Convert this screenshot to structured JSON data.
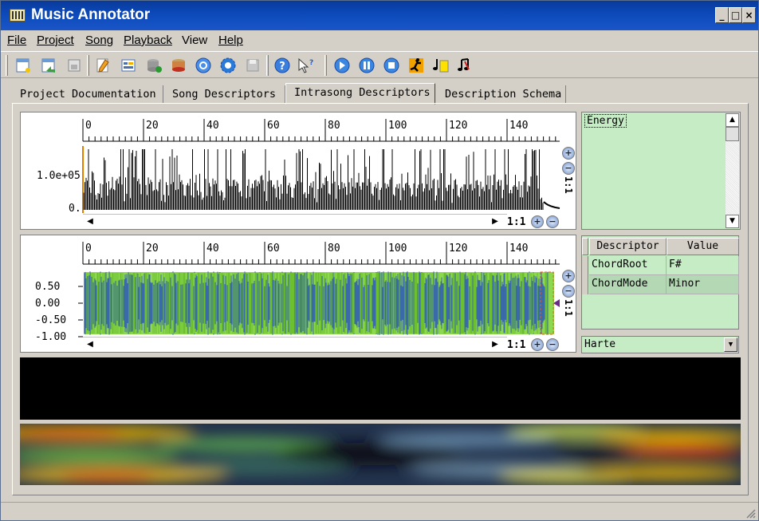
{
  "window": {
    "title": "Music Annotator",
    "min_label": "_",
    "max_label": "□",
    "close_label": "×"
  },
  "menu": [
    "File",
    "Project",
    "Song",
    "Playback",
    "View",
    "Help"
  ],
  "tabs": [
    {
      "label": "Project Documentation",
      "active": false
    },
    {
      "label": "Song Descriptors",
      "active": false
    },
    {
      "label": "Intrasong Descriptors",
      "active": true
    },
    {
      "label": "Description Schema",
      "active": false
    }
  ],
  "energy_plot": {
    "x_ticks": [
      "0",
      "20",
      "40",
      "60",
      "80",
      "100",
      "120",
      "140"
    ],
    "y_ticks": [
      "1.0e+05",
      "0."
    ],
    "zoom_ratio": "1:1",
    "v_ratio": "1:1"
  },
  "wave_plot": {
    "x_ticks": [
      "0",
      "20",
      "40",
      "60",
      "80",
      "100",
      "120",
      "140"
    ],
    "y_ticks": [
      "0.50",
      "0.00",
      "-0.50",
      "-1.00"
    ],
    "zoom_ratio": "1:1",
    "v_ratio": "1:1"
  },
  "descriptor_list": {
    "selected": "Energy"
  },
  "descriptor_table": {
    "headers": [
      "Descriptor",
      "Value"
    ],
    "rows": [
      {
        "descriptor": "ChordRoot",
        "value": "F#"
      },
      {
        "descriptor": "ChordMode",
        "value": "Minor"
      }
    ]
  },
  "schema_select": {
    "value": "Harte"
  },
  "icons": [
    "new-project-icon",
    "open-project-icon",
    "save-project-icon",
    "edit-icon",
    "properties-icon",
    "add-song-icon",
    "remove-song-icon",
    "refresh-icon",
    "settings-icon",
    "save-icon",
    "help-icon",
    "whats-this-icon",
    "play-icon",
    "pause-icon",
    "stop-icon",
    "runner-icon",
    "note-view-icon",
    "music-icon"
  ]
}
